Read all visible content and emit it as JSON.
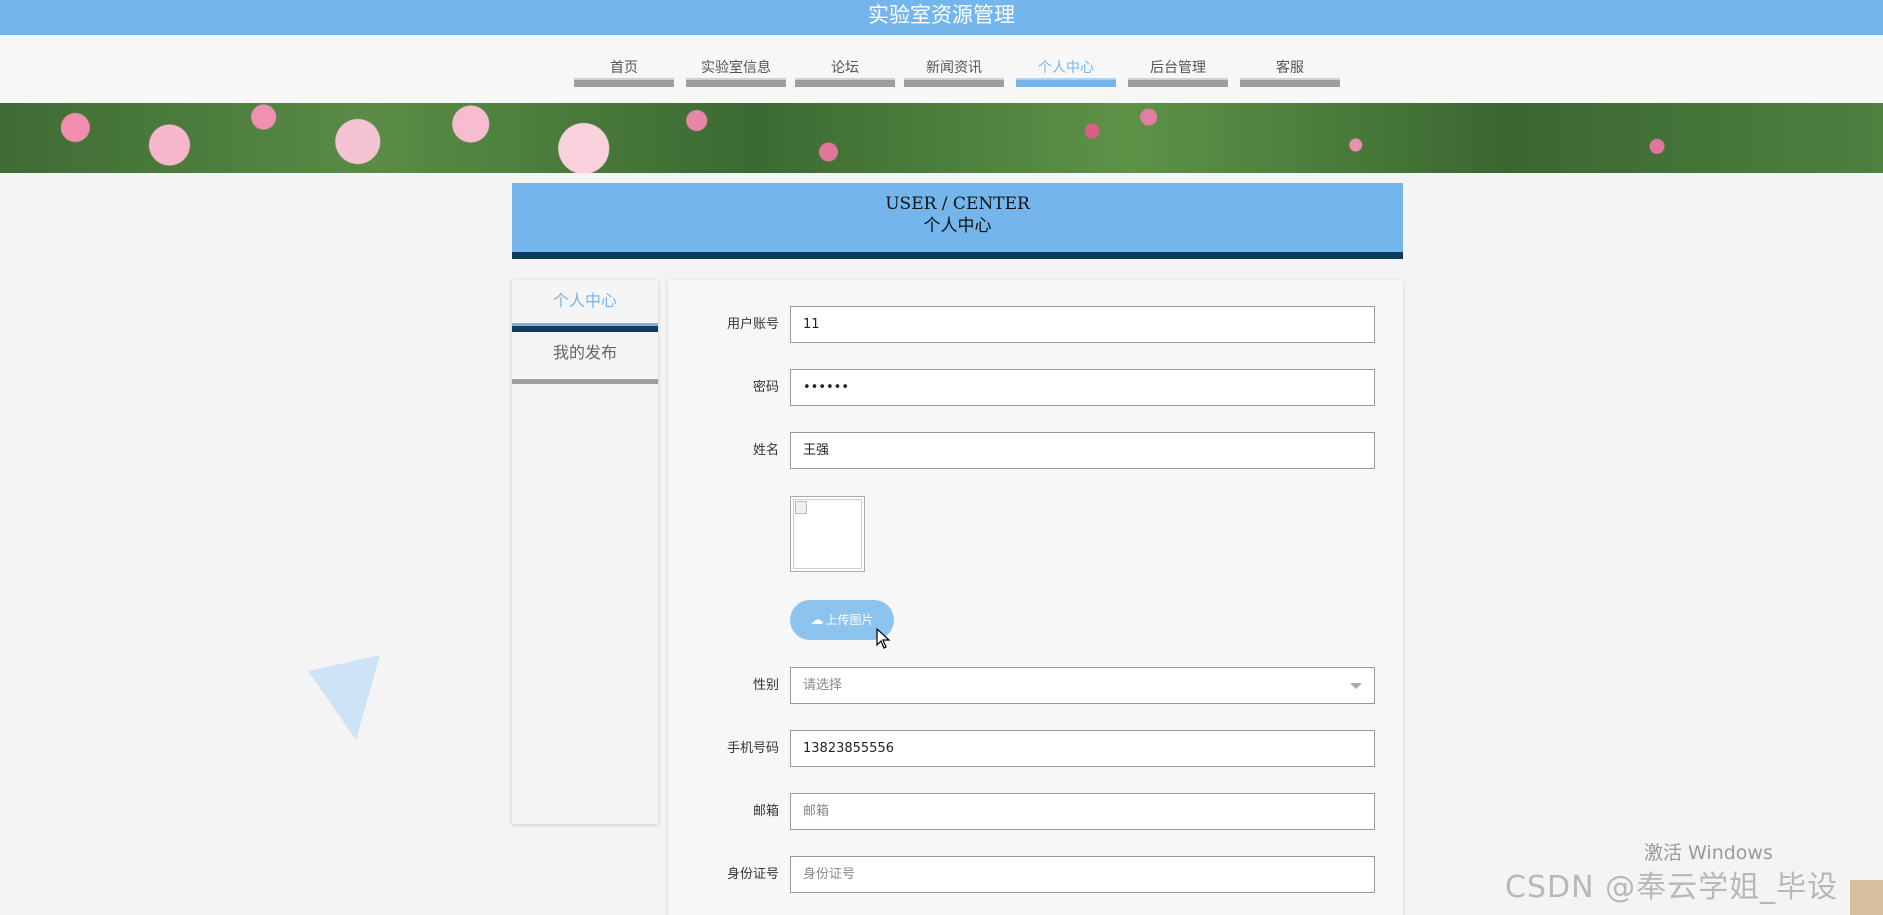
{
  "app": {
    "title": "实验室资源管理"
  },
  "nav": {
    "items": [
      {
        "label": "首页"
      },
      {
        "label": "实验室信息"
      },
      {
        "label": "论坛"
      },
      {
        "label": "新闻资讯"
      },
      {
        "label": "个人中心",
        "active": true
      },
      {
        "label": "后台管理"
      },
      {
        "label": "客服"
      }
    ]
  },
  "section": {
    "title_en": "USER / CENTER",
    "title_zh": "个人中心"
  },
  "sidebar": {
    "items": [
      {
        "label": "个人中心",
        "active": true
      },
      {
        "label": "我的发布"
      }
    ]
  },
  "form": {
    "account": {
      "label": "用户账号",
      "value": "11"
    },
    "password": {
      "label": "密码",
      "value": "••••••"
    },
    "name": {
      "label": "姓名",
      "value": "王强"
    },
    "upload": {
      "label": "上传图片",
      "icon": "cloud-upload-icon"
    },
    "gender": {
      "label": "性别",
      "placeholder": "请选择"
    },
    "phone": {
      "label": "手机号码",
      "value": "13823855556"
    },
    "email": {
      "label": "邮箱",
      "placeholder": "邮箱"
    },
    "id_card": {
      "label": "身份证号",
      "placeholder": "身份证号"
    }
  },
  "watermarks": {
    "windows": "激活 Windows",
    "csdn": "CSDN @奉云学姐_毕设"
  },
  "colors": {
    "primary": "#74b6eb",
    "dark": "#0f3a5e",
    "inactive_bar": "#9e9e9e"
  }
}
